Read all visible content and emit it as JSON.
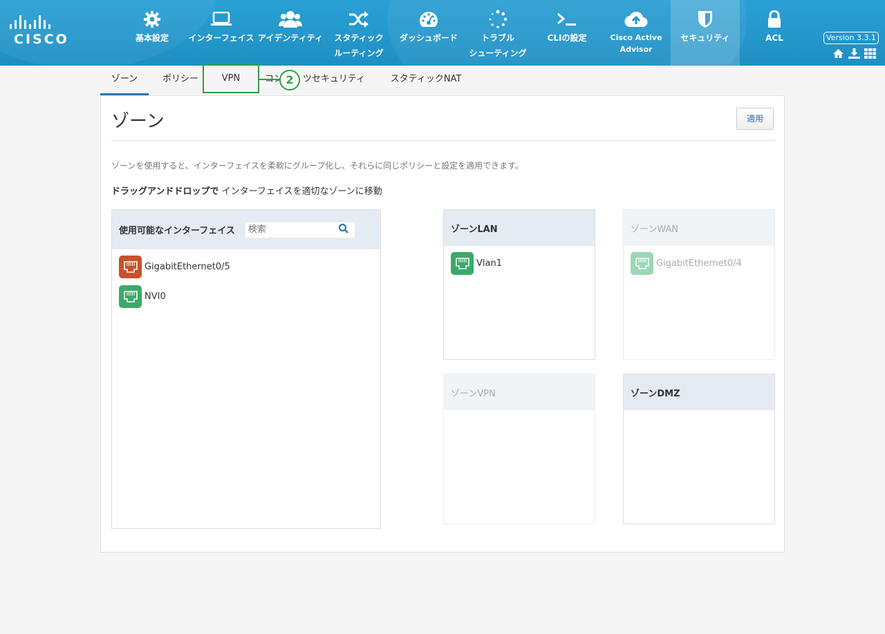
{
  "header": {
    "brand": "CISCO",
    "version": "Version 3.3.1",
    "nav": [
      {
        "label": "基本設定",
        "icon": "gear-icon"
      },
      {
        "label": "インターフェイス",
        "icon": "laptop-icon"
      },
      {
        "label": "アイデンティティ",
        "icon": "users-icon"
      },
      {
        "label1": "スタティック",
        "label2": "ルーティング",
        "icon": "shuffle-icon"
      },
      {
        "label": "ダッシュボード",
        "icon": "dashboard-icon"
      },
      {
        "label1": "トラブル",
        "label2": "シューティング",
        "icon": "spinner-icon"
      },
      {
        "label": "CLIの設定",
        "icon": "terminal-icon"
      },
      {
        "label1": "Cisco Active",
        "label2": "Advisor",
        "icon": "cloud-upload-icon"
      },
      {
        "label": "セキュリティ",
        "icon": "shield-icon"
      },
      {
        "label": "ACL",
        "icon": "lock-icon"
      }
    ],
    "utility_icons": [
      "home-icon",
      "download-icon",
      "grid-icon"
    ]
  },
  "tabs": {
    "zone": "ゾーン",
    "policy": "ポリシー",
    "vpn": "VPN",
    "content_security_prefix": "コン",
    "content_security_suffix": "ツセキュリティ",
    "static_nat": "スタティックNAT",
    "callout_number": "2"
  },
  "page": {
    "title": "ゾーン",
    "apply_button": "適用",
    "description": "ゾーンを使用すると、インターフェイスを柔軟にグループ化し、それらに同じポリシーと設定を適用できます。",
    "instruction_bold": "ドラッグアンドドロップで",
    "instruction_rest": " インターフェイスを適切なゾーンに移動"
  },
  "available": {
    "title": "使用可能なインターフェイス",
    "search_placeholder": "検索",
    "items": [
      {
        "name": "GigabitEthernet0/5",
        "color": "#c9502b"
      },
      {
        "name": "NVI0",
        "color": "#3aaa6a"
      }
    ]
  },
  "zones": {
    "lan": {
      "title": "ゾーンLAN",
      "items": [
        "Vlan1"
      ]
    },
    "wan": {
      "title": "ゾーンWAN",
      "items": [
        "GigabitEthernet0/4"
      ]
    },
    "vpn": {
      "title": "ゾーンVPN",
      "items": []
    },
    "dmz": {
      "title": "ゾーンDMZ",
      "items": []
    }
  },
  "colors": {
    "header": "#2aa0d4",
    "active_tab_underline": "#2a7ab0",
    "callout_green": "#2e9e46",
    "port_red": "#c9502b",
    "port_green": "#3aaa6a"
  }
}
